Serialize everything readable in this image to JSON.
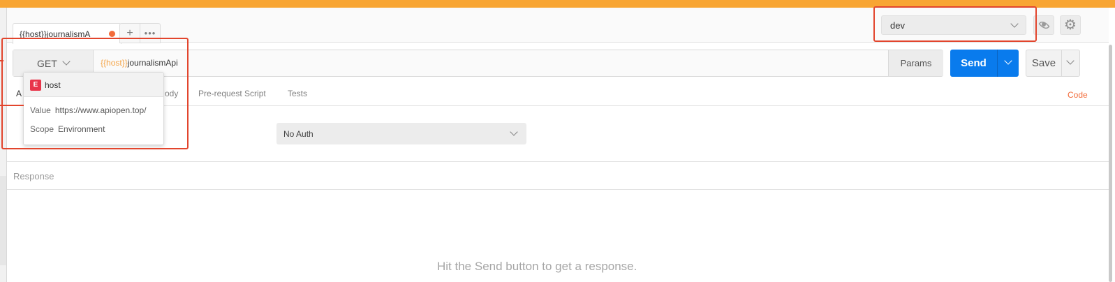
{
  "colors": {
    "accent": "#f26b3a",
    "send": "#097bed",
    "banner": "#f8a533",
    "variable": "#f5a64a",
    "highlight": "#e2452d"
  },
  "tab": {
    "label": "{{host}}journalismA",
    "unsaved_indicator": "orange-dot"
  },
  "tab_actions": {
    "add_label": "+",
    "more_label": "•••"
  },
  "environment": {
    "selected": "dev",
    "icons": [
      "eye-icon",
      "gear-icon"
    ]
  },
  "request": {
    "method": "GET",
    "url_variable": "{{host}}",
    "url_rest": "journalismApi",
    "params_label": "Params",
    "send_label": "Send",
    "save_label": "Save"
  },
  "subtabs": {
    "auth_partial": "A",
    "body_partial": "ody",
    "prerequest": "Pre-request Script",
    "tests": "Tests",
    "code": "Code"
  },
  "auth": {
    "type": "No Auth"
  },
  "variable_popover": {
    "badge": "E",
    "name": "host",
    "value_key": "Value",
    "value": "https://www.apiopen.top/",
    "scope_key": "Scope",
    "scope": "Environment"
  },
  "response": {
    "label": "Response",
    "hint": "Hit the Send button to get a response."
  }
}
